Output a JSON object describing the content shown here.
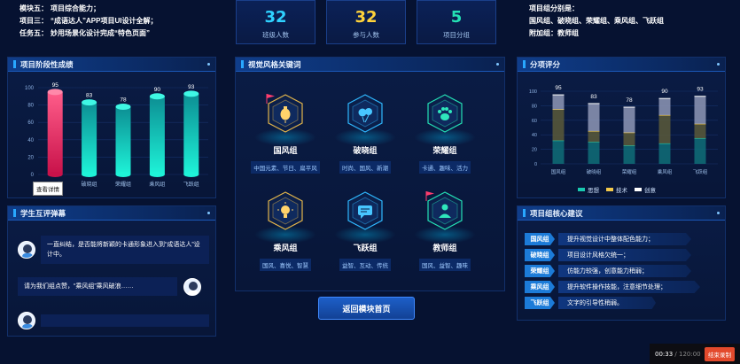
{
  "top_left": {
    "lines": [
      {
        "label": "模块五：",
        "text": "项目综合能力；"
      },
      {
        "label": "项目三：",
        "text": "“成语达人”APP项目UI设计全解；"
      },
      {
        "label": "任务五：",
        "text": "妙用场景化设计完成“特色页面”"
      }
    ]
  },
  "stats": [
    {
      "value": "32",
      "label": "班级人数",
      "color": "#2fd2ff"
    },
    {
      "value": "32",
      "label": "参与人数",
      "color": "#ffd23a"
    },
    {
      "value": "5",
      "label": "项目分组",
      "color": "#24e0b4"
    }
  ],
  "top_right": {
    "line1": "项目组分别是：",
    "line2": "国风组、破晓组、荣耀组、乘风组、飞跃组",
    "line3": "附加组：教师组"
  },
  "stage_panel": {
    "title": "项目阶段性成绩",
    "tooltip": "查看详情"
  },
  "chat_panel": {
    "title": "学生互评弹幕",
    "messages": [
      {
        "text": "一直纠结，是否能将新颖的卡通形象进入到“成语达人”设计中。"
      },
      {
        "text": "请为我们组点赞，“乘风组”乘风破浪……"
      }
    ]
  },
  "keyword_panel": {
    "title": "视觉风格关键词",
    "items": [
      {
        "name": "国风组",
        "tags": "中国元素、节日、扁平风",
        "color": "#e3b54a",
        "icon": "lantern-icon"
      },
      {
        "name": "破晓组",
        "tags": "时尚、国风、新潮",
        "color": "#2fb8ff",
        "icon": "balloon-icon"
      },
      {
        "name": "荣耀组",
        "tags": "卡通、趣味、活力",
        "color": "#24e0b4",
        "icon": "paw-icon"
      },
      {
        "name": "乘风组",
        "tags": "国风、喜悦、智慧",
        "color": "#e3b54a",
        "icon": "bulb-icon"
      },
      {
        "name": "飞跃组",
        "tags": "益智、互动、传统",
        "color": "#2fb8ff",
        "icon": "chat-icon"
      },
      {
        "name": "教师组",
        "tags": "国风、益智、趣味",
        "color": "#24e0b4",
        "icon": "teacher-icon"
      }
    ],
    "return_button": "返回模块首页"
  },
  "score_panel": {
    "title": "分项评分",
    "legend": [
      {
        "name": "思想",
        "color": "#19c9b0"
      },
      {
        "name": "技术",
        "color": "#f3c94a"
      },
      {
        "name": "创意",
        "color": "#ffffff"
      }
    ]
  },
  "suggest_panel": {
    "title": "项目组核心建议",
    "items": [
      {
        "group": "国风组",
        "text": "提升视觉设计中整体配色能力；"
      },
      {
        "group": "破晓组",
        "text": "项目设计风格欠统一；"
      },
      {
        "group": "荣耀组",
        "text": "仿能力较强，创意能力稍弱；"
      },
      {
        "group": "乘风组",
        "text": "提升软件操作技能，注意细节处理；"
      },
      {
        "group": "飞跃组",
        "text": "文字的引导性稍弱。"
      }
    ]
  },
  "timer": {
    "elapsed": "00:33",
    "total": "/ 120:00",
    "end_button": "结束录制"
  },
  "chart_data": [
    {
      "type": "bar",
      "categories": [
        "国风组",
        "破晓组",
        "荣耀组",
        "乘风组",
        "飞跃组"
      ],
      "values": [
        95,
        83,
        78,
        90,
        93
      ],
      "ylim": [
        0,
        100
      ],
      "yticks": [
        0,
        20,
        40,
        60,
        80,
        100
      ],
      "colors": [
        "#ff3d6e",
        "#19e6d0",
        "#19e6d0",
        "#19e6d0",
        "#19e6d0"
      ]
    },
    {
      "type": "bar",
      "stacked": true,
      "categories": [
        "国风组",
        "破晓组",
        "荣耀组",
        "乘风组",
        "飞跃组"
      ],
      "totals": [
        95,
        83,
        78,
        90,
        93
      ],
      "ylim": [
        0,
        100
      ],
      "yticks": [
        0,
        20,
        40,
        60,
        80,
        100
      ],
      "series": [
        {
          "name": "思想",
          "values": [
            32,
            30,
            25,
            28,
            35
          ],
          "color": "#19c9b0"
        },
        {
          "name": "技术",
          "values": [
            43,
            15,
            18,
            39,
            20
          ],
          "color": "#f3c94a"
        },
        {
          "name": "创意",
          "values": [
            20,
            38,
            35,
            23,
            38
          ],
          "color": "#ffffff"
        }
      ],
      "legend_position": "bottom"
    }
  ]
}
